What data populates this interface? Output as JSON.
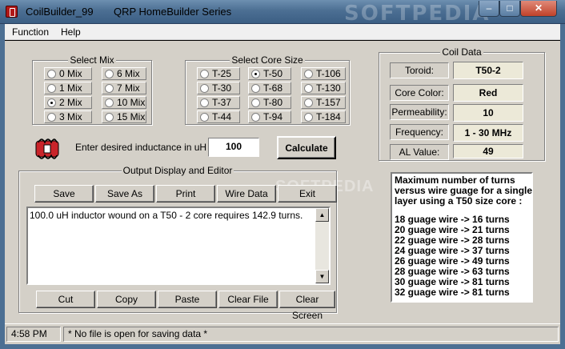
{
  "window": {
    "app_name": "CoilBuilder_99",
    "series_name": "QRP HomeBuilder Series",
    "watermark": "SOFTPEDIA"
  },
  "menu": [
    "Function",
    "Help"
  ],
  "select_mix": {
    "title": "Select Mix",
    "options": [
      "0 Mix",
      "6 Mix",
      "1 Mix",
      "7 Mix",
      "2 Mix",
      "10 Mix",
      "3 Mix",
      "15 Mix"
    ],
    "selected": "2 Mix"
  },
  "select_core": {
    "title": "Select Core Size",
    "options": [
      "T-25",
      "T-50",
      "T-106",
      "T-30",
      "T-68",
      "T-130",
      "T-37",
      "T-80",
      "T-157",
      "T-44",
      "T-94",
      "T-184"
    ],
    "selected": "T-50"
  },
  "inductance": {
    "label": "Enter desired inductance in uH :",
    "value": "100",
    "calculate_label": "Calculate"
  },
  "output": {
    "title": "Output Display and Editor",
    "top_buttons": [
      "Save",
      "Save As",
      "Print",
      "Wire Data",
      "Exit"
    ],
    "bottom_buttons": [
      "Cut",
      "Copy",
      "Paste",
      "Clear File",
      "Clear Screen"
    ],
    "text": "100.0 uH inductor wound on a T50 - 2 core requires 142.9 turns."
  },
  "coil_data": {
    "title": "Coil Data",
    "toroid_label": "Toroid:",
    "toroid": "T50-2",
    "color_label": "Core Color:",
    "color": "Red",
    "perm_label": "Permeability:",
    "perm": "10",
    "freq_label": "Frequency:",
    "freq": "1 - 30 MHz",
    "al_label": "AL Value:",
    "al": "49"
  },
  "turns": {
    "header": [
      "Maximum number of turns",
      "versus wire guage for a single",
      "layer using a T50  size core :"
    ],
    "rows": [
      "18 guage wire -> 16 turns",
      "20 guage wire -> 21 turns",
      "22 guage wire -> 28 turns",
      "24 guage wire -> 37 turns",
      "26 guage wire -> 49 turns",
      "28 guage wire -> 63 turns",
      "30 guage wire -> 81 turns",
      "32 guage wire -> 81 turns"
    ]
  },
  "status": {
    "time": "4:58 PM",
    "message": "* No file is open for saving data *"
  }
}
